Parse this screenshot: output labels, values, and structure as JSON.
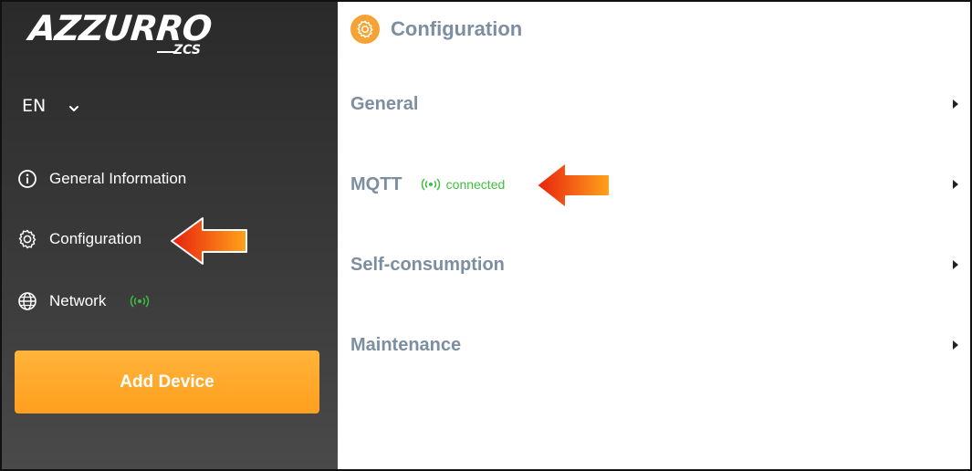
{
  "brand": {
    "logo_main": "AZZURRO",
    "logo_sub": "ZCS"
  },
  "language": {
    "selected": "EN"
  },
  "sidebar": {
    "items": [
      {
        "label": "General Information",
        "icon": "info-icon"
      },
      {
        "label": "Configuration",
        "icon": "gear-icon"
      },
      {
        "label": "Network",
        "icon": "globe-icon",
        "status_icon": "signal-icon"
      }
    ],
    "add_device_label": "Add Device"
  },
  "main": {
    "title": "Configuration",
    "title_icon": "gear-icon",
    "sections": [
      {
        "label": "General"
      },
      {
        "label": "MQTT",
        "status": "connected",
        "status_icon": "signal-icon"
      },
      {
        "label": "Self-consumption"
      },
      {
        "label": "Maintenance"
      }
    ]
  },
  "colors": {
    "accent": "#f7a234",
    "text_muted": "#7c8ea0",
    "status_green": "#3fbf3f",
    "sidebar_bg": "#333333",
    "annotation_arrow": "#f04a12"
  }
}
